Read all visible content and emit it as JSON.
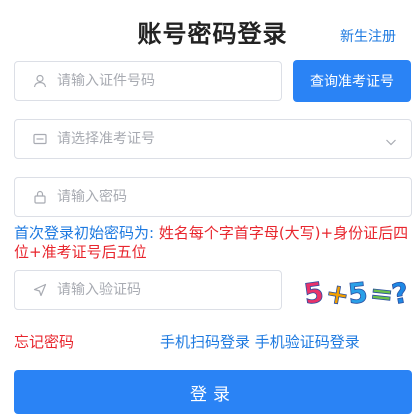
{
  "header": {
    "title": "账号密码登录",
    "register_link": "新生注册"
  },
  "form": {
    "id_placeholder": "请输入证件号码",
    "query_button": "查询准考证号",
    "exam_select_placeholder": "请选择准考证号",
    "password_placeholder": "请输入密码",
    "captcha_placeholder": "请输入验证码"
  },
  "hint": {
    "prefix": "首次登录初始密码为: ",
    "rule": "姓名每个字首字母(大写)+身份证后四位+准考证号后五位"
  },
  "captcha": {
    "text": "5+5=?",
    "colors": [
      "#e8326a",
      "#f4a000",
      "#2aa0e8",
      "#6cc24a",
      "#1e88e5"
    ]
  },
  "links": {
    "forgot_password": "忘记密码",
    "qr_login": "手机扫码登录",
    "sms_login": "手机验证码登录"
  },
  "login_button": "登录",
  "colors": {
    "primary": "#2a83f5",
    "link_blue": "#1e7ae0",
    "warning_red": "#e8262e"
  },
  "icons": [
    "user-icon",
    "id-card-icon",
    "chevron-down-icon",
    "lock-icon",
    "send-icon"
  ]
}
